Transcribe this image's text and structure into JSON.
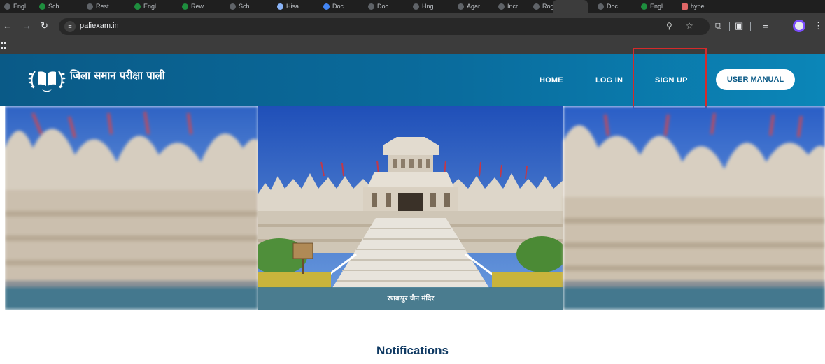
{
  "browser": {
    "url": "paliexam.in",
    "tabs": [
      {
        "title": "Engl"
      },
      {
        "title": "Sch"
      },
      {
        "title": "Rest"
      },
      {
        "title": "Engl"
      },
      {
        "title": "Rew"
      },
      {
        "title": "Sch"
      },
      {
        "title": "Hisa"
      },
      {
        "title": "Doc"
      },
      {
        "title": "Doc"
      },
      {
        "title": "Hng"
      },
      {
        "title": "Agar"
      },
      {
        "title": "Incr"
      },
      {
        "title": "Rogi"
      },
      {
        "title": ""
      },
      {
        "title": "Doc"
      },
      {
        "title": "Engl"
      },
      {
        "title": "hype"
      }
    ],
    "icons": {
      "back": "arrow-left-icon",
      "forward": "arrow-right-icon",
      "reload": "reload-icon",
      "site_info": "tune-icon",
      "zoom": "zoom-icon",
      "bookmark": "star-icon",
      "extensions": "puzzle-icon",
      "tab_search": "tab-search-icon",
      "reading": "reading-list-icon",
      "menu": "kebab-menu-icon"
    }
  },
  "site": {
    "title": "जिला समान परीक्षा पाली",
    "nav": {
      "home": "HOME",
      "login": "LOG IN",
      "signup": "SIGN UP",
      "manual": "USER MANUAL"
    },
    "slider": {
      "caption": "रणकपुर जैन मंदिर"
    },
    "notifications_heading": "Notifications"
  },
  "colors": {
    "header_start": "#0a5a87",
    "header_end": "#0b86b8",
    "highlight": "#d62a2a",
    "heading": "#103a63"
  }
}
